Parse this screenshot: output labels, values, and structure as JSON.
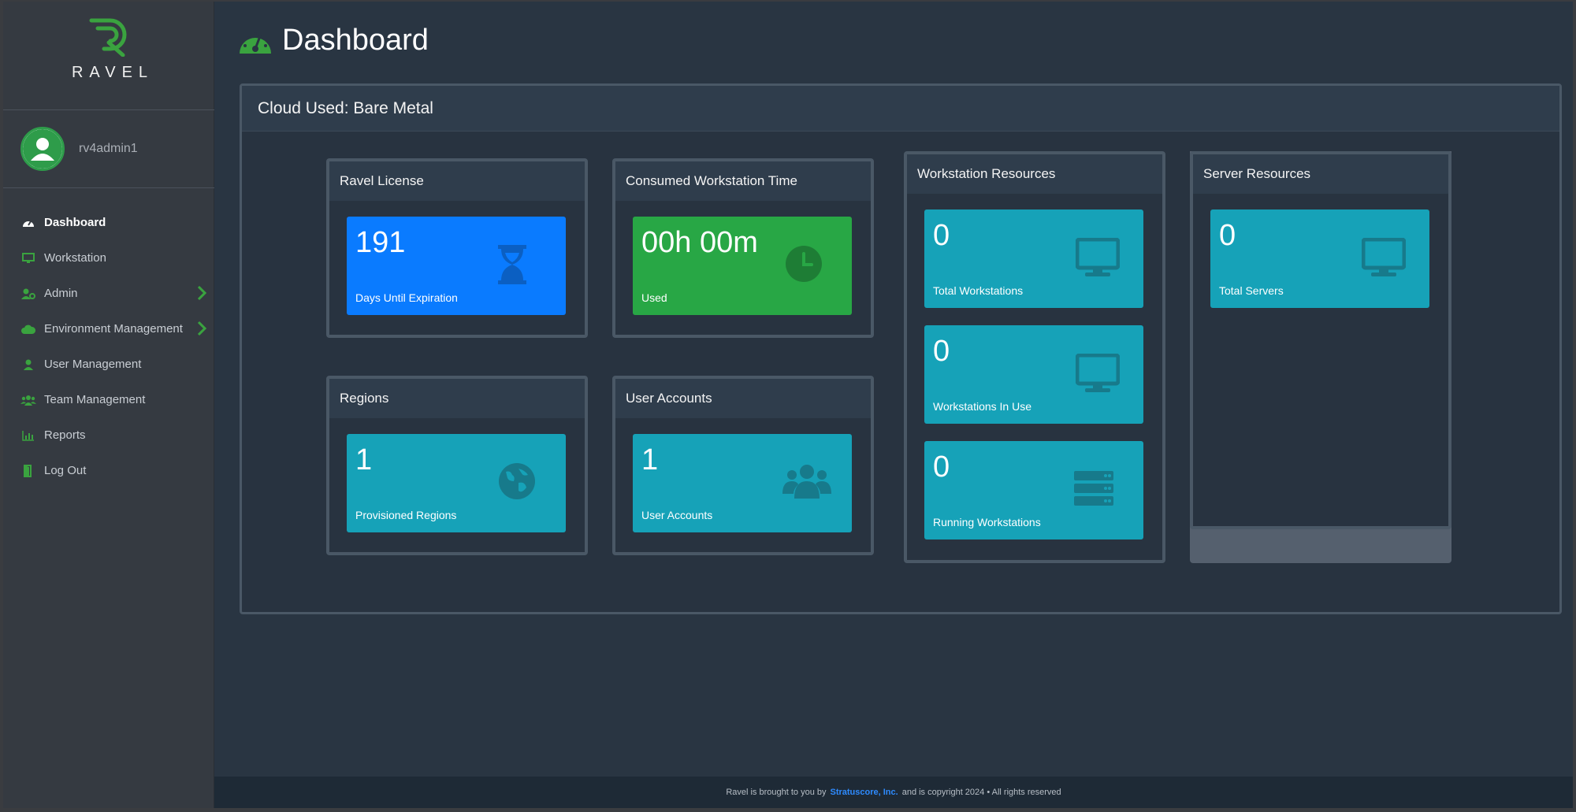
{
  "brand": {
    "name": "RAVEL",
    "color": "#3aa33f"
  },
  "user": {
    "name": "rv4admin1"
  },
  "nav": [
    {
      "label": "Dashboard",
      "icon": "gauge-icon",
      "active": true
    },
    {
      "label": "Workstation",
      "icon": "monitor-icon"
    },
    {
      "label": "Admin",
      "icon": "user-cog-icon",
      "submenu": true
    },
    {
      "label": "Environment Management",
      "icon": "cloud-icon",
      "submenu": true
    },
    {
      "label": "User Management",
      "icon": "user-icon"
    },
    {
      "label": "Team Management",
      "icon": "users-icon"
    },
    {
      "label": "Reports",
      "icon": "chart-icon"
    },
    {
      "label": "Log Out",
      "icon": "door-icon"
    }
  ],
  "page": {
    "title": "Dashboard"
  },
  "panel": {
    "title": "Cloud Used: Bare Metal"
  },
  "cards": {
    "license": {
      "title": "Ravel License",
      "value": "191",
      "caption": "Days Until Expiration",
      "icon": "hourglass-icon"
    },
    "time": {
      "title": "Consumed Workstation Time",
      "value": "00h 00m",
      "caption": "Used",
      "icon": "clock-icon"
    },
    "regions": {
      "title": "Regions",
      "value": "1",
      "caption": "Provisioned Regions",
      "icon": "globe-icon"
    },
    "accounts": {
      "title": "User Accounts",
      "value": "1",
      "caption": "User Accounts",
      "icon": "users-icon"
    },
    "workstation_resources": {
      "title": "Workstation Resources",
      "tiles": [
        {
          "value": "0",
          "caption": "Total Workstations",
          "icon": "monitor-icon"
        },
        {
          "value": "0",
          "caption": "Workstations In Use",
          "icon": "monitor-icon"
        },
        {
          "value": "0",
          "caption": "Running Workstations",
          "icon": "server-icon"
        }
      ]
    },
    "server_resources": {
      "title": "Server Resources",
      "tiles": [
        {
          "value": "0",
          "caption": "Total Servers",
          "icon": "monitor-icon"
        }
      ]
    }
  },
  "footer": {
    "prefix": "Ravel is brought to you by",
    "link": "Stratuscore, Inc.",
    "suffix": "and is copyright 2024 • All rights reserved"
  }
}
